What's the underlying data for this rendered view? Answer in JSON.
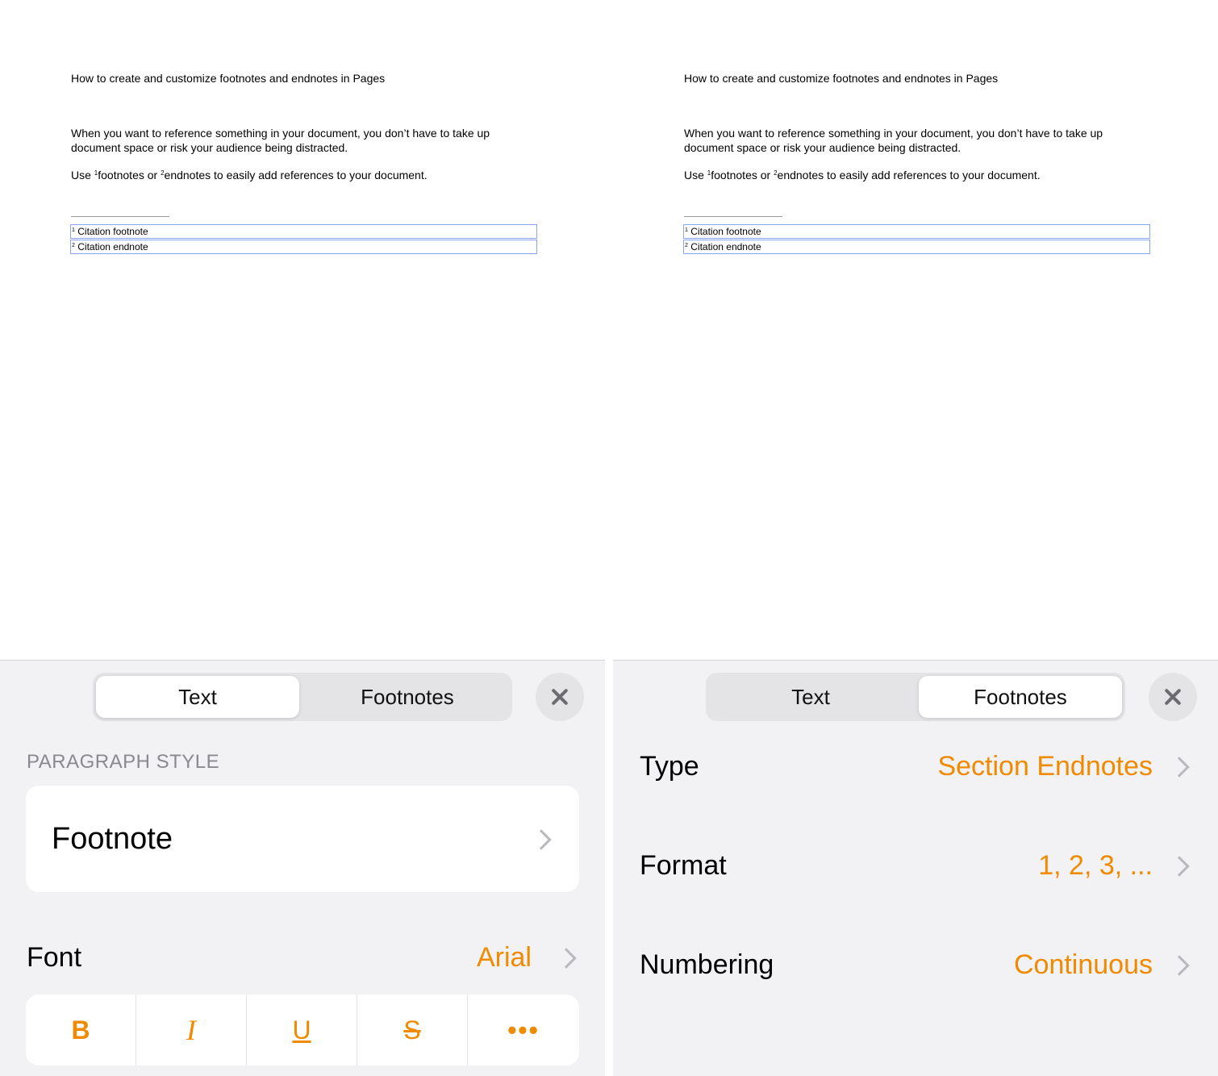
{
  "document": {
    "title": "How to create and customize footnotes and endnotes in Pages",
    "paragraph1": "When you want to reference something in your document, you don’t have to take up document space or risk your audience being distracted.",
    "paragraph2": {
      "prefix": "Use ",
      "ref1": "1",
      "word1": "footnotes or ",
      "ref2": "2",
      "word2": "endnotes to easily add references to your document."
    },
    "notes": [
      {
        "marker": "1",
        "text": "Citation footnote"
      },
      {
        "marker": "2",
        "text": "Citation endnote"
      }
    ]
  },
  "left_sheet": {
    "tabs": [
      "Text",
      "Footnotes"
    ],
    "active_tab": "Text",
    "section_header": "PARAGRAPH STYLE",
    "paragraph_style": "Footnote",
    "font_label": "Font",
    "font_value": "Arial",
    "format_buttons": {
      "bold": "B",
      "italic": "I",
      "underline": "U",
      "strikethrough": "S",
      "more": "•••"
    }
  },
  "right_sheet": {
    "tabs": [
      "Text",
      "Footnotes"
    ],
    "active_tab": "Footnotes",
    "rows": [
      {
        "label": "Type",
        "value": "Section Endnotes"
      },
      {
        "label": "Format",
        "value": "1, 2, 3, ..."
      },
      {
        "label": "Numbering",
        "value": "Continuous"
      }
    ]
  },
  "colors": {
    "accent": "#f08a00",
    "sheet_bg": "#f2f2f4",
    "note_border": "#8aa6f0"
  }
}
